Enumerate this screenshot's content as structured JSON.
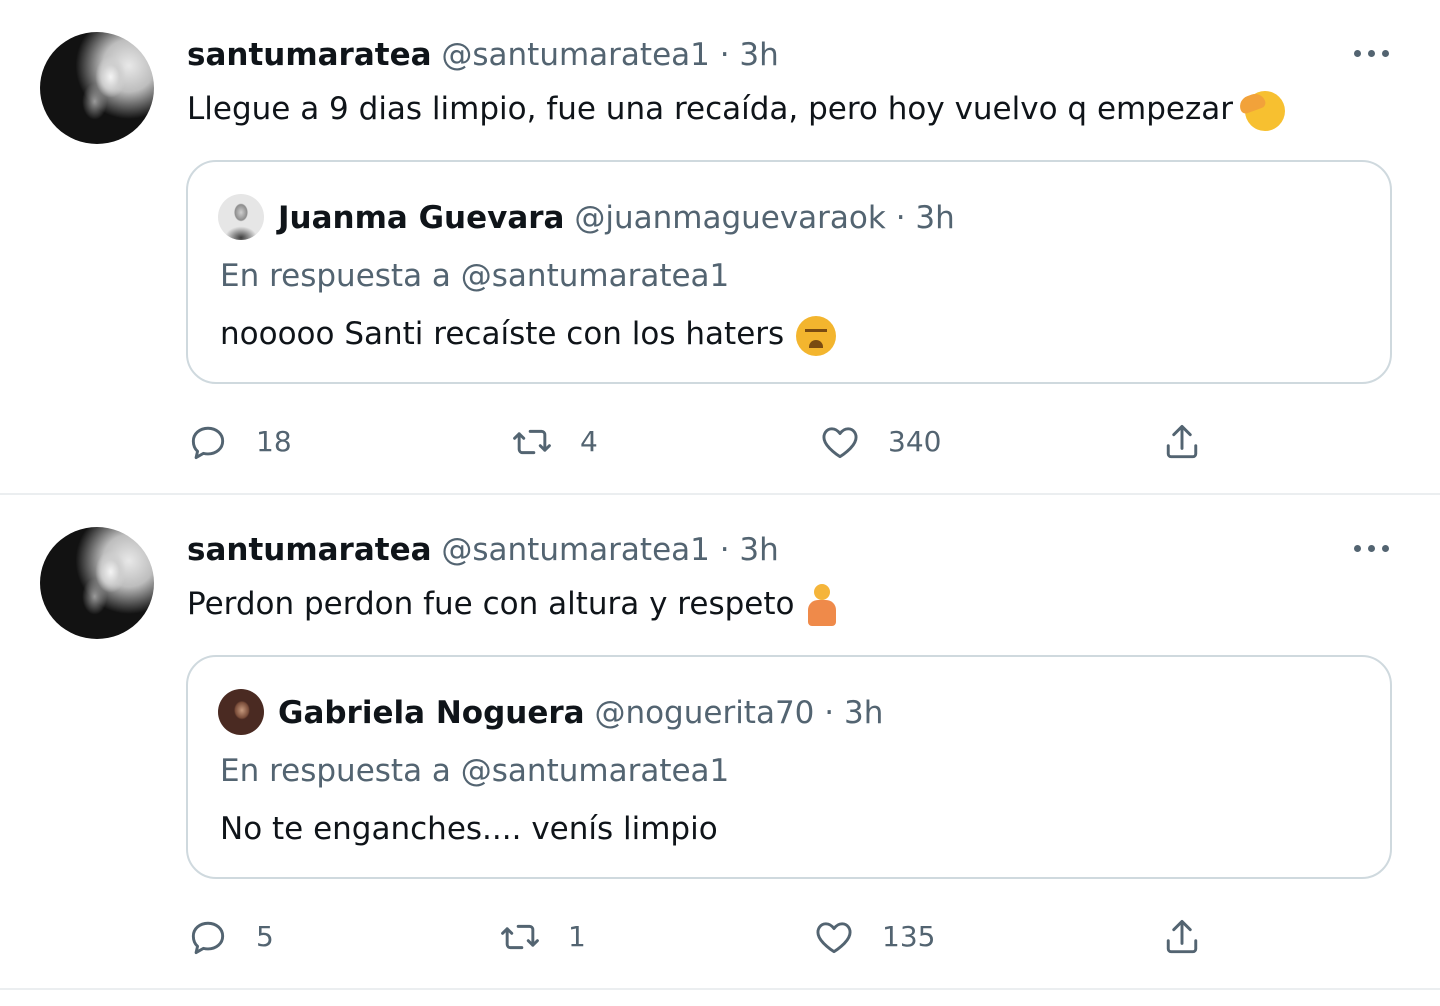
{
  "tweets": [
    {
      "author_name": "santumaratea",
      "meta": "@santumaratea1 · 3h",
      "text": "Llegue a 9 dias limpio, fue una recaída, pero hoy vuelvo q empezar",
      "emoji": "face-with-hand-over-mouth-emoji",
      "quote": {
        "author_name": "Juanma Guevara",
        "meta": "@juanmaguevaraok · 3h",
        "reply_to": "En respuesta a @santumaratea1",
        "text": "nooooo Santi recaíste con los haters",
        "emoji": "tired-face-emoji"
      },
      "replies": "18",
      "retweets": "4",
      "likes": "340"
    },
    {
      "author_name": "santumaratea",
      "meta": "@santumaratea1 · 3h",
      "text": "Perdon perdon fue con altura y respeto",
      "emoji": "person-in-lotus-position-emoji",
      "quote": {
        "author_name": "Gabriela Noguera",
        "meta": "@noguerita70 · 3h",
        "reply_to": "En respuesta a @santumaratea1",
        "text": "No te enganches.... venís limpio"
      },
      "replies": "5",
      "retweets": "1",
      "likes": "135"
    }
  ],
  "icons": {
    "reply": "reply-icon",
    "retweet": "retweet-icon",
    "like": "heart-icon",
    "share": "share-icon",
    "more": "more-options-icon"
  },
  "colors": {
    "text": "#0f1419",
    "secondary": "#536471",
    "border": "#cfd9de"
  }
}
